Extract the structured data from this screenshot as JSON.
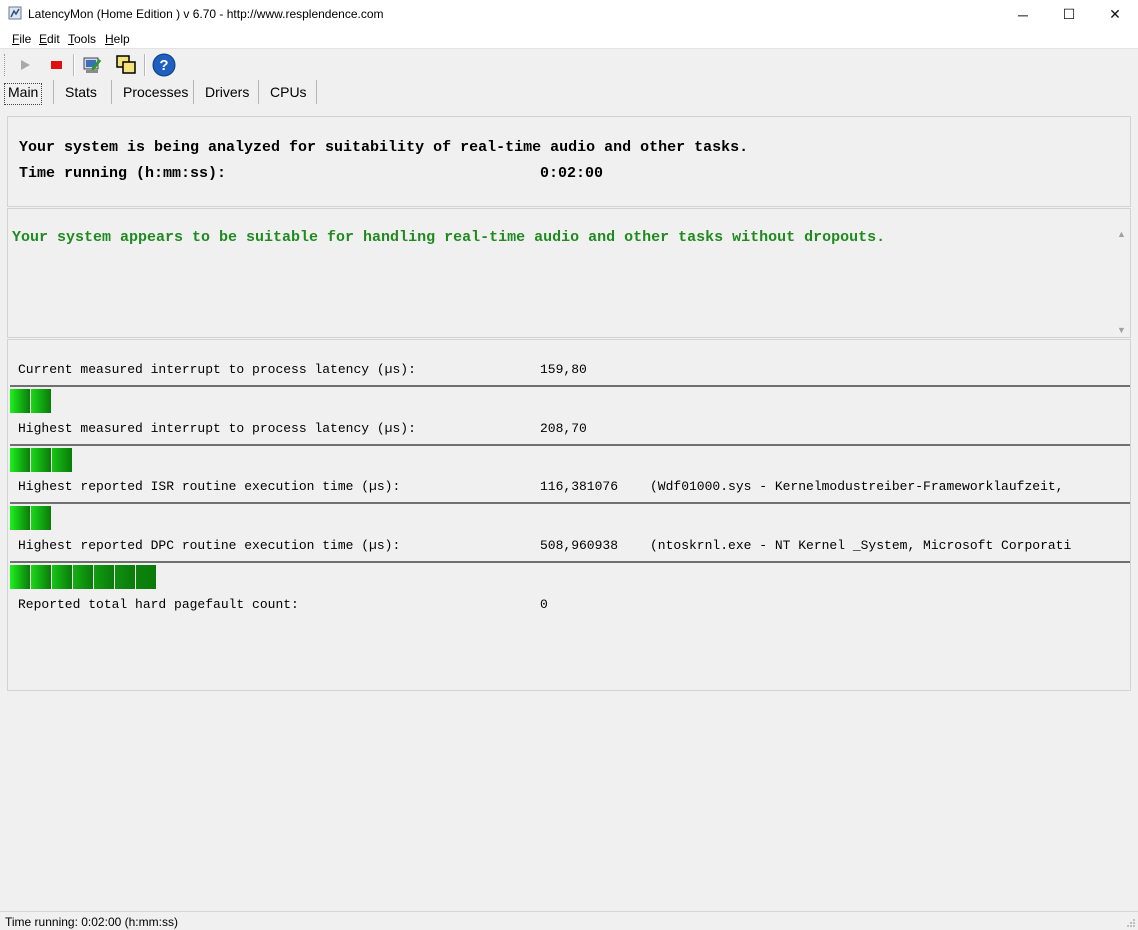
{
  "window": {
    "title": "LatencyMon  (Home Edition )  v 6.70 - http://www.resplendence.com",
    "minimize_glyph": "─",
    "maximize_glyph": "☐",
    "close_glyph": "✕"
  },
  "menu": {
    "items": [
      {
        "key": "F",
        "rest": "ile"
      },
      {
        "key": "E",
        "rest": "dit"
      },
      {
        "key": "T",
        "rest": "ools"
      },
      {
        "key": "H",
        "rest": "elp"
      }
    ]
  },
  "toolbar": {
    "icons": [
      "play-icon",
      "stop-icon",
      "analyze-icon",
      "windows-icon",
      "help-icon"
    ]
  },
  "tabs": [
    {
      "label": "Main"
    },
    {
      "label": "Stats"
    },
    {
      "label": "Processes"
    },
    {
      "label": "Drivers"
    },
    {
      "label": "CPUs"
    }
  ],
  "status_panel": {
    "line1": "Your system is being analyzed for suitability of real-time audio and other tasks.",
    "time_label": "Time running (h:mm:ss):",
    "time_value": "0:02:00"
  },
  "verdict": {
    "message": "Your system appears to be suitable for handling real-time audio and other tasks without dropouts.",
    "color": "#1f8a1f"
  },
  "metrics": [
    {
      "label": "Current measured interrupt to process latency (µs):",
      "value": "159,80",
      "extra": "",
      "segments": 2
    },
    {
      "label": "Highest measured interrupt to process latency (µs):",
      "value": "208,70",
      "extra": "",
      "segments": 3
    },
    {
      "label": "Highest reported ISR routine execution time (µs):",
      "value": "116,381076",
      "extra": "(Wdf01000.sys - Kernelmodustreiber-Frameworklaufzeit,",
      "segments": 2
    },
    {
      "label": "Highest reported DPC routine execution time (µs):",
      "value": "508,960938",
      "extra": "(ntoskrnl.exe - NT Kernel _System, Microsoft Corporati",
      "segments": 7
    },
    {
      "label": "Reported total hard pagefault count:",
      "value": "0",
      "extra": ""
    }
  ],
  "statusbar": {
    "text": "Time running: 0:02:00  (h:mm:ss)"
  }
}
